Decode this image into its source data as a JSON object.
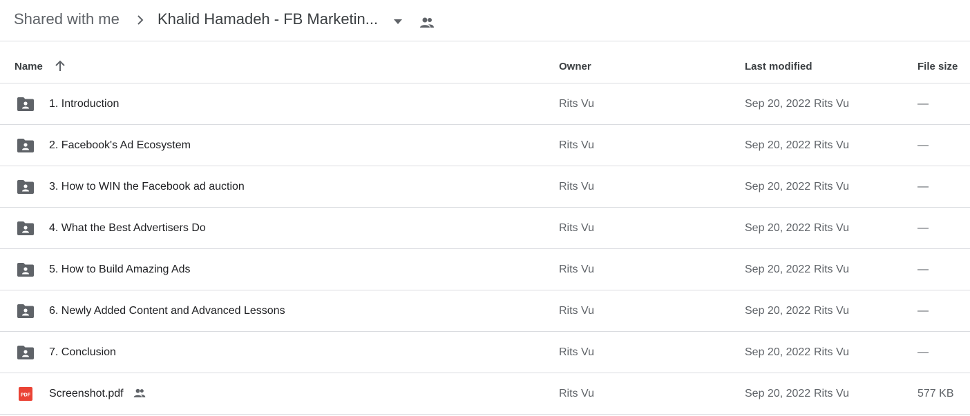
{
  "breadcrumb": {
    "root": "Shared with me",
    "current": "Khalid Hamadeh - FB Marketin..."
  },
  "columns": {
    "name": "Name",
    "owner": "Owner",
    "last_modified": "Last modified",
    "file_size": "File size"
  },
  "rows": [
    {
      "name": "1. Introduction",
      "owner": "Rits Vu",
      "date": "Sep 20, 2022",
      "modified_by": "Rits Vu",
      "size": "—",
      "type": "shared-folder-icon",
      "shared": false
    },
    {
      "name": "2. Facebook's Ad Ecosystem",
      "owner": "Rits Vu",
      "date": "Sep 20, 2022",
      "modified_by": "Rits Vu",
      "size": "—",
      "type": "shared-folder-icon",
      "shared": false
    },
    {
      "name": "3. How to WIN the Facebook ad auction",
      "owner": "Rits Vu",
      "date": "Sep 20, 2022",
      "modified_by": "Rits Vu",
      "size": "—",
      "type": "shared-folder-icon",
      "shared": false
    },
    {
      "name": "4. What the Best Advertisers Do",
      "owner": "Rits Vu",
      "date": "Sep 20, 2022",
      "modified_by": "Rits Vu",
      "size": "—",
      "type": "shared-folder-icon",
      "shared": false
    },
    {
      "name": "5. How to Build Amazing Ads",
      "owner": "Rits Vu",
      "date": "Sep 20, 2022",
      "modified_by": "Rits Vu",
      "size": "—",
      "type": "shared-folder-icon",
      "shared": false
    },
    {
      "name": "6. Newly Added Content and Advanced Lessons",
      "owner": "Rits Vu",
      "date": "Sep 20, 2022",
      "modified_by": "Rits Vu",
      "size": "—",
      "type": "shared-folder-icon",
      "shared": false
    },
    {
      "name": "7. Conclusion",
      "owner": "Rits Vu",
      "date": "Sep 20, 2022",
      "modified_by": "Rits Vu",
      "size": "—",
      "type": "shared-folder-icon",
      "shared": false
    },
    {
      "name": "Screenshot.pdf",
      "owner": "Rits Vu",
      "date": "Sep 20, 2022",
      "modified_by": "Rits Vu",
      "size": "577 KB",
      "type": "pdf-icon",
      "shared": true,
      "pdf_badge": "PDF"
    }
  ],
  "colors": {
    "folder": "#5f6368",
    "pdf": "#ea4335",
    "divider": "#dadce0",
    "text_secondary": "#5f6368"
  }
}
